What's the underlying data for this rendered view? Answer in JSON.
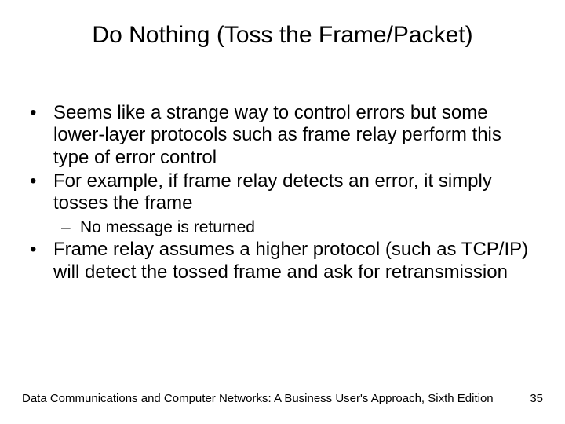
{
  "title": "Do Nothing (Toss the Frame/Packet)",
  "bullets": {
    "b1": "Seems like a strange way to control errors but some lower-layer protocols such as frame relay perform this type of error control",
    "b2": "For example, if frame relay detects an error, it simply tosses the frame",
    "b2_sub1": "No message is returned",
    "b3": "Frame relay assumes a higher protocol (such as TCP/IP) will detect the tossed frame and ask for retransmission"
  },
  "footer": {
    "source": "Data Communications and Computer Networks: A Business User's Approach, Sixth Edition",
    "page": "35"
  }
}
